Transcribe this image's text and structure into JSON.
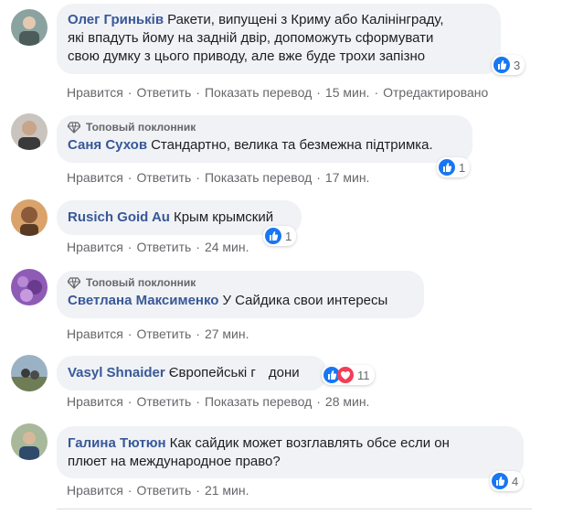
{
  "colors": {
    "bubble": "#f0f2f5",
    "author": "#385898",
    "meta": "#65676b",
    "like": "#1877f2",
    "love": "#f33e58"
  },
  "actions": {
    "like": "Нравится",
    "reply": "Ответить",
    "translate": "Показать перевод",
    "sep": "·"
  },
  "comments": [
    {
      "author": "Олег Гриньків",
      "text_line1": "Ракети, випущені з Криму або Калінінграду,",
      "text_line2": "які впадуть йому на задній двір, допоможуть сформувати",
      "text_line3": "свою думку з цього приводу, але вже буде трохи запізно",
      "time": "15 мин.",
      "edited": "Отредактировано",
      "reactions": {
        "icons": [
          "like-icon"
        ],
        "count": "3"
      }
    },
    {
      "fan_badge": "Топовый поклонник",
      "author": "Саня Сухов",
      "text": "Стандартно, велика та безмежна підтримка.",
      "time": "17 мин.",
      "reactions": {
        "icons": [
          "like-icon"
        ],
        "count": "1"
      }
    },
    {
      "author": "Rusich Goid Au",
      "text": "Крым крымский",
      "time": "24 мин.",
      "reactions": {
        "icons": [
          "like-icon"
        ],
        "count": "1"
      }
    },
    {
      "fan_badge": "Топовый поклонник",
      "author": "Светлана Максименко",
      "text": "У Сайдика свои интересы",
      "time": "27 мин."
    },
    {
      "author": "Vasyl Shnaider",
      "text": "Європейські г",
      "text_tail": "дони",
      "time": "28 мин.",
      "reactions": {
        "icons": [
          "like-icon",
          "love-icon"
        ],
        "count": "11"
      }
    },
    {
      "author": "Галина Тютюн",
      "text_line1": "Как сайдик может возглавлять обсе если он",
      "text_line2": "плюет на международное право?",
      "time": "21 мин.",
      "reactions": {
        "icons": [
          "like-icon"
        ],
        "count": "4"
      }
    }
  ]
}
